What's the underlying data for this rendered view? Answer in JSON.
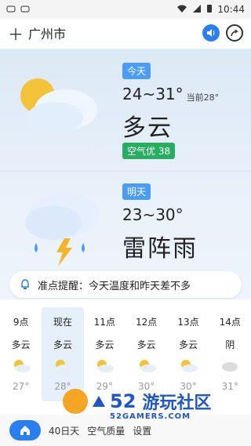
{
  "status": {
    "time": "10:44",
    "icons": [
      "notification-icon-1",
      "notification-icon-2",
      "wifi-icon",
      "signal-icon",
      "battery-icon"
    ]
  },
  "topbar": {
    "add_icon": "plus-icon",
    "city": "广州市",
    "sound_icon": "speaker-icon",
    "share_icon": "share-icon"
  },
  "today": {
    "badge": "今天",
    "temp_range": "24~31°",
    "current": "当前28°",
    "condition": "多云",
    "aqi": "空气优 38"
  },
  "tomorrow": {
    "badge": "明天",
    "temp_range": "23~30°",
    "condition": "雷阵雨"
  },
  "reminder": {
    "icon": "bell-icon",
    "text": "准点提醒：今天温度和昨天差不多"
  },
  "hourly": [
    {
      "time": "9点",
      "cond": "多云",
      "temp": "27°"
    },
    {
      "time": "现在",
      "cond": "多云",
      "temp": "28°"
    },
    {
      "time": "11点",
      "cond": "多云",
      "temp": "29°"
    },
    {
      "time": "12点",
      "cond": "多云",
      "temp": "30°"
    },
    {
      "time": "13点",
      "cond": "多云",
      "temp": "30°"
    },
    {
      "time": "14点",
      "cond": "阴",
      "temp": "31°"
    }
  ],
  "bottom_nav": {
    "items": [
      "40日天",
      "空气质量",
      "设置"
    ]
  },
  "watermark": {
    "num": "52",
    "cn": "游玩社区",
    "en": "52GAMERS.COM"
  },
  "colors": {
    "accent": "#2a7ef0",
    "aqi_green": "#27ae60",
    "badge_blue": "#4a9cf5"
  }
}
